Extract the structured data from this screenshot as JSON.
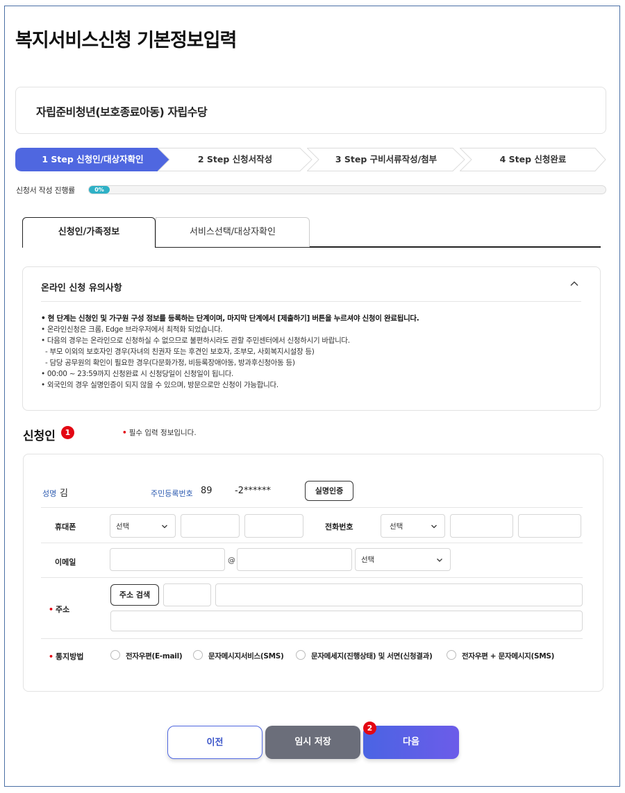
{
  "page_title": "복지서비스신청 기본정보입력",
  "service_name": "자립준비청년(보호종료아동) 자립수당",
  "steps": [
    {
      "label": "1 Step 신청인/대상자확인",
      "active": true
    },
    {
      "label": "2 Step 신청서작성",
      "active": false
    },
    {
      "label": "3 Step 구비서류작성/첨부",
      "active": false
    },
    {
      "label": "4 Step 신청완료",
      "active": false
    }
  ],
  "progress": {
    "label": "신청서 작성 진행률",
    "value_text": "0%",
    "value": 0
  },
  "tabs": [
    {
      "label": "신청인/가족정보",
      "active": true
    },
    {
      "label": "서비스선택/대상자확인",
      "active": false
    }
  ],
  "notice": {
    "title": "온라인 신청 유의사항",
    "items": [
      "• 현 단계는 신청인 및 가구원 구성 정보를 등록하는 단계이며, 마지막 단계에서 [제출하기] 버튼을 누르셔야 신청이 완료됩니다.",
      "• 온라인신청은 크롬, Edge 브라우저에서 최적화 되었습니다.",
      "• 다음의 경우는 온라인으로 신청하실 수 없으므로 불편하시라도 관할 주민센터에서 신청하시기 바랍니다.",
      "- 부모 이외의 보호자인 경우(자녀의 친권자 또는 후견인 보호자, 조부모, 사회복지시설장 등)",
      "- 담당 공무원의 확인이 필요한 경우(다문화가정, 비등록장애아동, 방과후신청아동 등)",
      "• 00:00 ~ 23:59까지 신청완료 시 신청당일이 신청일이 됩니다.",
      "• 외국인의 경우 실명인증이 되지 않을 수 있으며, 방문으로만 신청이 가능합니다."
    ]
  },
  "applicant": {
    "section_title": "신청인",
    "badge": "1",
    "required_note": "필수 입력 정보입니다.",
    "name_label": "성명",
    "name_value": "김",
    "rrn_label": "주민등록번호",
    "rrn_front": "89",
    "rrn_back": "-2******",
    "verify_button": "실명인증",
    "mobile_label": "휴대폰",
    "mobile_select": "선택",
    "phone_label": "전화번호",
    "phone_select": "선택",
    "email_label": "이메일",
    "email_at": "@",
    "email_select": "선택",
    "address_label": "주소",
    "address_search_button": "주소 검색",
    "notify_label": "통지방법",
    "notify_options": [
      "전자우편(E-mail)",
      "문자메시지서비스(SMS)",
      "문자메세지(진행상태) 및 서면(신청결과)",
      "전자우편 + 문자메시지(SMS)"
    ]
  },
  "buttons": {
    "prev": "이전",
    "temp_save": "임시 저장",
    "next": "다음",
    "next_badge": "2"
  },
  "colors": {
    "step_active": "#4f67e0",
    "progress": "#2fb1c6",
    "required": "#e30613",
    "label_blue": "#2b5ab0",
    "next_button": "#5b5fe6",
    "temp_save_button": "#6b6e7a"
  }
}
